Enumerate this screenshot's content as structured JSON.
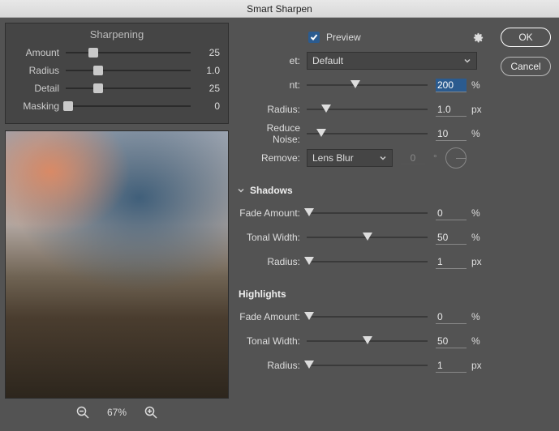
{
  "title": "Smart Sharpen",
  "overlay": {
    "title": "Sharpening",
    "amount": {
      "label": "Amount",
      "value": "25",
      "pos": 22
    },
    "radius": {
      "label": "Radius",
      "value": "1.0",
      "pos": 26
    },
    "detail": {
      "label": "Detail",
      "value": "25",
      "pos": 26
    },
    "masking": {
      "label": "Masking",
      "value": "0",
      "pos": 2
    }
  },
  "zoom": {
    "level": "67%"
  },
  "top": {
    "preview_label": "Preview",
    "preset_label": "et:",
    "preset_value": "Default"
  },
  "main": {
    "amount": {
      "label": "nt:",
      "value": "200",
      "unit": "%",
      "pos": 40
    },
    "radius": {
      "label": "Radius:",
      "value": "1.0",
      "unit": "px",
      "pos": 16
    },
    "noise": {
      "label": "Reduce Noise:",
      "value": "10",
      "unit": "%",
      "pos": 12
    },
    "remove": {
      "label": "Remove:",
      "value": "Lens Blur",
      "angle": "0"
    }
  },
  "shadows": {
    "title": "Shadows",
    "fade": {
      "label": "Fade Amount:",
      "value": "0",
      "unit": "%",
      "pos": 2
    },
    "tonal": {
      "label": "Tonal Width:",
      "value": "50",
      "unit": "%",
      "pos": 50
    },
    "radius": {
      "label": "Radius:",
      "value": "1",
      "unit": "px",
      "pos": 2
    }
  },
  "highlights": {
    "title": "Highlights",
    "fade": {
      "label": "Fade Amount:",
      "value": "0",
      "unit": "%",
      "pos": 2
    },
    "tonal": {
      "label": "Tonal Width:",
      "value": "50",
      "unit": "%",
      "pos": 50
    },
    "radius": {
      "label": "Radius:",
      "value": "1",
      "unit": "px",
      "pos": 2
    }
  },
  "buttons": {
    "ok": "OK",
    "cancel": "Cancel"
  }
}
